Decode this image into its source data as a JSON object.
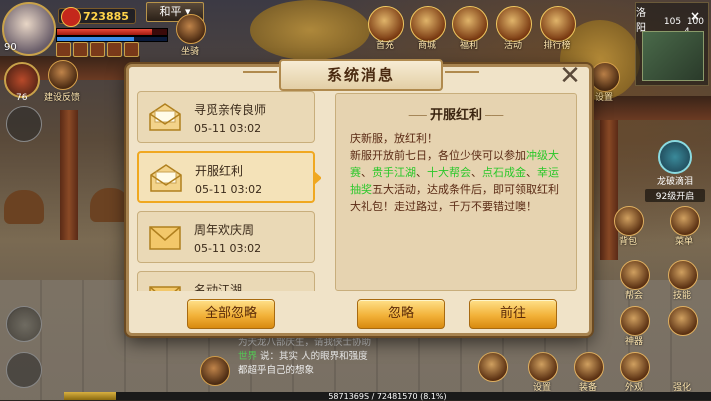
{
  "hud": {
    "player_level": "90",
    "combat_power": "723885",
    "pk_mode": "和平",
    "pet_level": "76",
    "top_icons": [
      "首充",
      "商城",
      "福利",
      "活动",
      "排行榜"
    ],
    "small_labels": [
      "设置",
      "坐骑",
      "建设反馈"
    ],
    "minimap": {
      "map_name": "洛阳",
      "coords": "105  100\n       4",
      "close": "×"
    },
    "event": {
      "title": "龙破滴泪",
      "level_text": "92级开启"
    },
    "right_labels": [
      "背包",
      "菜单",
      "帮会",
      "技能",
      "神器",
      "强化",
      "外观"
    ],
    "bottom_labels": [
      "设置",
      "装备",
      "外观"
    ],
    "chat": {
      "line1": "为天龙八部庆生，请我侠士协助",
      "world_tag": "世界",
      "world_line": "说：其实 人的眼界和强度",
      "line3": "都超乎自己的想象"
    },
    "xp_text": "5871369S / 72481570 (8.1%)",
    "xp_fraction": 0.081
  },
  "dialog": {
    "title": "系统消息",
    "close": "✕",
    "messages": [
      {
        "title": "寻觅亲传良师",
        "time": "05-11 03:02",
        "read": true,
        "selected": false
      },
      {
        "title": "开服红利",
        "time": "05-11 03:02",
        "read": true,
        "selected": true
      },
      {
        "title": "周年欢庆周",
        "time": "05-11 03:02",
        "read": false,
        "selected": false
      },
      {
        "title": "名动江湖",
        "time": "",
        "read": false,
        "selected": false
      }
    ],
    "content": {
      "title": "开服红利",
      "greeting": "庆新服，放红利！",
      "intro": "新服开放前七日，各位少侠可以参加",
      "events": [
        "冲级大赛",
        "贵手江湖",
        "十大帮会",
        "点石成金",
        "幸运抽奖"
      ],
      "sep": "、",
      "outro": "五大活动，达成条件后，即可领取红利大礼包！走过路过，千万不要错过噢！"
    },
    "buttons": {
      "ignore_all": "全部忽略",
      "ignore": "忽略",
      "go": "前往"
    }
  }
}
